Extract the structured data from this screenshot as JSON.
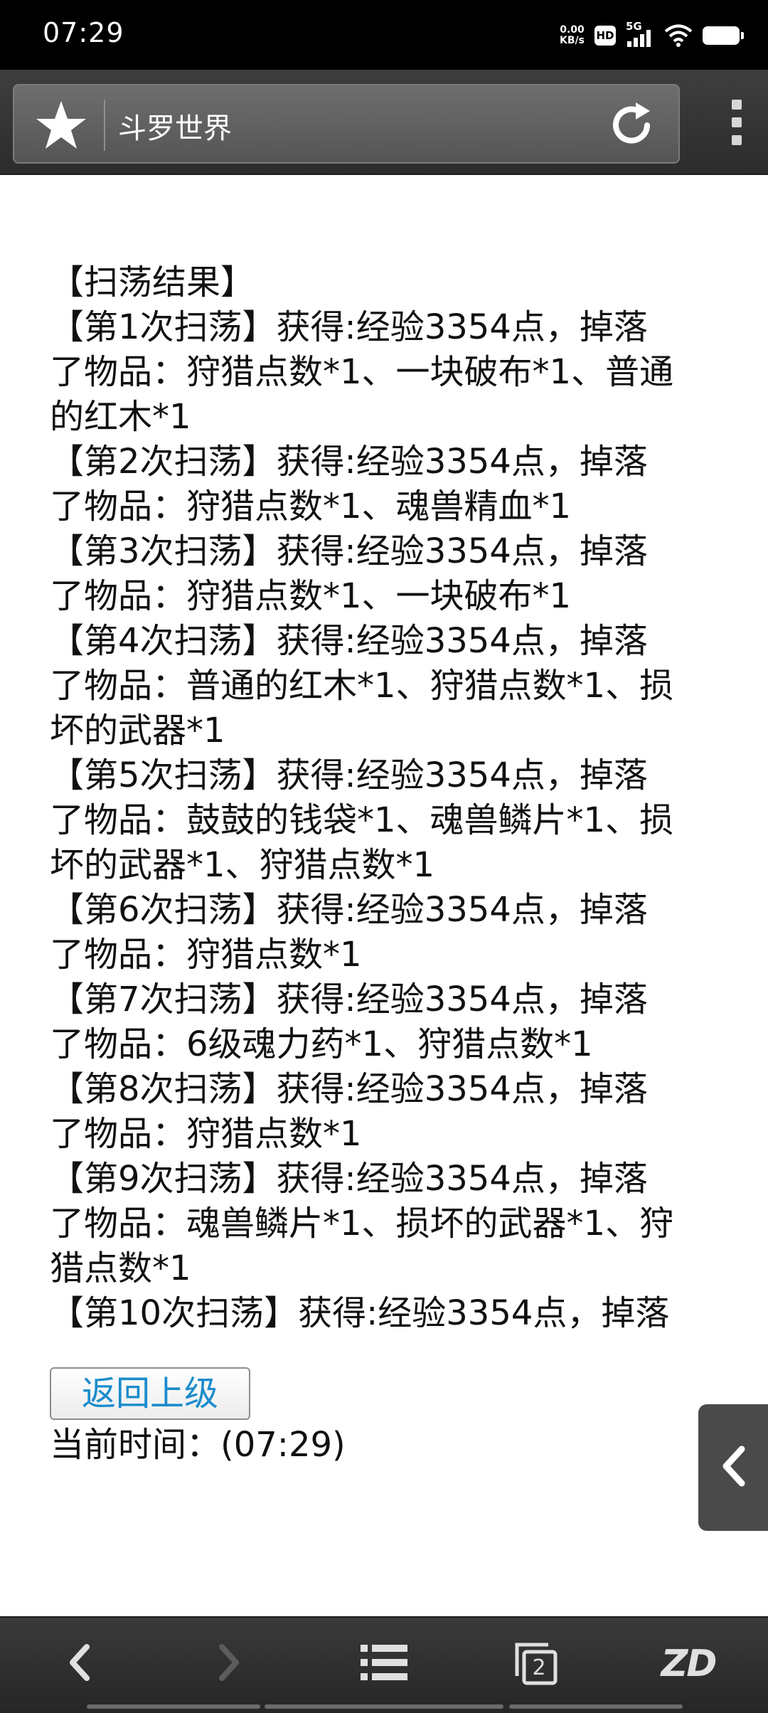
{
  "status_bar": {
    "time": "07:29",
    "net_speed_value": "0.00",
    "net_speed_unit": "KB/s",
    "hd_badge": "HD",
    "network": "5G"
  },
  "browser": {
    "page_title": "斗罗世界",
    "tab_count": "2",
    "logo": "ZD"
  },
  "content": {
    "lines": [
      "【扫荡结果】",
      "【第1次扫荡】获得:经验3354点，掉落",
      "了物品：狩猎点数*1、一块破布*1、普通",
      "的红木*1",
      "【第2次扫荡】获得:经验3354点，掉落",
      "了物品：狩猎点数*1、魂兽精血*1",
      "【第3次扫荡】获得:经验3354点，掉落",
      "了物品：狩猎点数*1、一块破布*1",
      "【第4次扫荡】获得:经验3354点，掉落",
      "了物品：普通的红木*1、狩猎点数*1、损",
      "坏的武器*1",
      "【第5次扫荡】获得:经验3354点，掉落",
      "了物品：鼓鼓的钱袋*1、魂兽鳞片*1、损",
      "坏的武器*1、狩猎点数*1",
      "【第6次扫荡】获得:经验3354点，掉落",
      "了物品：狩猎点数*1",
      "【第7次扫荡】获得:经验3354点，掉落",
      "了物品：6级魂力药*1、狩猎点数*1",
      "【第8次扫荡】获得:经验3354点，掉落",
      "了物品：狩猎点数*1",
      "【第9次扫荡】获得:经验3354点，掉落",
      "了物品：魂兽鳞片*1、损坏的武器*1、狩",
      "猎点数*1",
      "【第10次扫荡】获得:经验3354点，掉落"
    ],
    "back_button": "返回上级",
    "current_time": "当前时间：(07:29)"
  }
}
